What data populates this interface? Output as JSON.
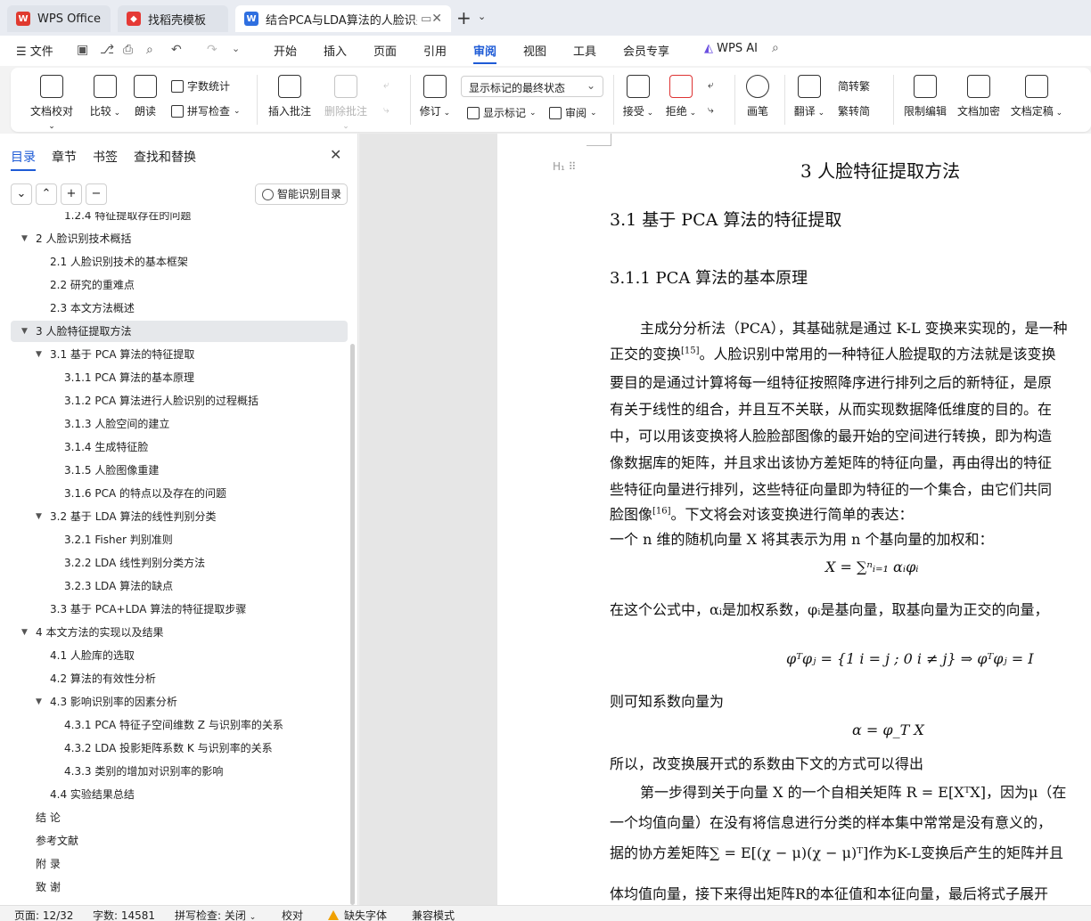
{
  "tabs": [
    {
      "label": "WPS Office",
      "icon": "wps-logo-icon",
      "color": "#e03a2f"
    },
    {
      "label": "找稻壳模板",
      "icon": "docer-icon",
      "color": "#e53935"
    },
    {
      "label": "结合PCA与LDA算法的人脸识别",
      "icon": "word-doc-icon",
      "color": "#2f6fe0"
    }
  ],
  "menu": {
    "file": "文件",
    "items": [
      "开始",
      "插入",
      "页面",
      "引用",
      "审阅",
      "视图",
      "工具",
      "会员专享"
    ],
    "active": "审阅",
    "wps_ai": "WPS AI"
  },
  "ribbon": {
    "proofread": "文档校对",
    "compare": "比较",
    "read_aloud": "朗读",
    "word_count": "字数统计",
    "spell_check": "拼写检查",
    "insert_comment": "插入批注",
    "delete_comment": "删除批注",
    "track_changes": "修订",
    "markup_state": "显示标记的最终状态",
    "show_markup": "显示标记",
    "review_pane": "审阅",
    "accept": "接受",
    "reject": "拒绝",
    "pen": "画笔",
    "translate": "翻译",
    "to_traditional": "简转繁",
    "to_simplified": "繁转简",
    "restrict_edit": "限制编辑",
    "encrypt": "文档加密",
    "finalize": "文档定稿"
  },
  "navpane": {
    "tabs": [
      "目录",
      "章节",
      "书签",
      "查找和替换"
    ],
    "active_tab": "目录",
    "smart_toc": "智能识别目录",
    "toc": [
      {
        "text": "1.2.4 特征提取存在的问题",
        "level": 3
      },
      {
        "text": "2 人脸识别技术概括",
        "level": 1,
        "toggle": "▼"
      },
      {
        "text": "2.1 人脸识别技术的基本框架",
        "level": 2
      },
      {
        "text": "2.2 研究的重难点",
        "level": 2
      },
      {
        "text": "2.3 本文方法概述",
        "level": 2
      },
      {
        "text": "3 人脸特征提取方法",
        "level": 1,
        "toggle": "▼",
        "selected": true
      },
      {
        "text": "3.1 基于 PCA 算法的特征提取",
        "level": 2,
        "toggle": "▼"
      },
      {
        "text": "3.1.1 PCA 算法的基本原理",
        "level": 3
      },
      {
        "text": "3.1.2 PCA 算法进行人脸识别的过程概括",
        "level": 3
      },
      {
        "text": "3.1.3 人脸空间的建立",
        "level": 3
      },
      {
        "text": "3.1.4 生成特征脸",
        "level": 3
      },
      {
        "text": "3.1.5 人脸图像重建",
        "level": 3
      },
      {
        "text": "3.1.6 PCA 的特点以及存在的问题",
        "level": 3
      },
      {
        "text": "3.2 基于 LDA 算法的线性判别分类",
        "level": 2,
        "toggle": "▼"
      },
      {
        "text": "3.2.1 Fisher 判别准则",
        "level": 3
      },
      {
        "text": "3.2.2 LDA 线性判别分类方法",
        "level": 3
      },
      {
        "text": "3.2.3 LDA 算法的缺点",
        "level": 3
      },
      {
        "text": "3.3 基于 PCA+LDA 算法的特征提取步骤",
        "level": 2
      },
      {
        "text": "4 本文方法的实现以及结果",
        "level": 1,
        "toggle": "▼"
      },
      {
        "text": "4.1 人脸库的选取",
        "level": 2
      },
      {
        "text": "4.2 算法的有效性分析",
        "level": 2
      },
      {
        "text": "4.3 影响识别率的因素分析",
        "level": 2,
        "toggle": "▼"
      },
      {
        "text": "4.3.1 PCA 特征子空间维数 Z 与识别率的关系",
        "level": 3
      },
      {
        "text": "4.3.2 LDA 投影矩阵系数 K 与识别率的关系",
        "level": 3
      },
      {
        "text": "4.3.3 类别的增加对识别率的影响",
        "level": 3
      },
      {
        "text": "4.4 实验结果总结",
        "level": 2
      },
      {
        "text": "结 论",
        "level": 1
      },
      {
        "text": "参考文献",
        "level": 1
      },
      {
        "text": "附 录",
        "level": 1
      },
      {
        "text": "致 谢",
        "level": 1
      }
    ]
  },
  "document": {
    "heading_handle": "H₁ ⠿",
    "h1": "3 人脸特征提取方法",
    "h2": "3.1 基于 PCA 算法的特征提取",
    "h3": "3.1.1 PCA 算法的基本原理",
    "lines": [
      "主成分分析法（PCA），其基础就是通过 K-L 变换来实现的，是一种",
      "正交的变换",
      "。人脸识别中常用的一种特征人脸提取的方法就是该变换",
      "要目的是通过计算将每一组特征按照降序进行排列之后的新特征，是原",
      "有关于线性的组合，并且互不关联，从而实现数据降低维度的目的。在",
      "中，可以用该变换将人脸脸部图像的最开始的空间进行转换，即为构造",
      "像数据库的矩阵，并且求出该协方差矩阵的特征向量，再由得出的特征",
      "些特征向量进行排列，这些特征向量即为特征的一个集合，由它们共同",
      "脸图像",
      "。下文将会对该变换进行简单的表达：",
      "一个 n 维的随机向量 X 将其表示为用 n 个基向量的加权和：",
      "X = ∑ⁿᵢ₌₁ αᵢφᵢ",
      "在这个公式中，αᵢ是加权系数，φᵢ是基向量，取基向量为正交的向量，",
      "φᵀφⱼ = {1  i = j ; 0  i ≠ j} ⇒ φᵀφⱼ = I",
      "则可知系数向量为",
      "α = φ_T X",
      "所以，改变换展开式的系数由下文的方式可以得出",
      "第一步得到关于向量 X 的一个自相关矩阵 R = E[XᵀX]，因为μ（在",
      "一个均值向量）在没有将信息进行分类的样本集中常常是没有意义的，",
      "据的协方差矩阵∑ = E[(χ − μ)(χ − μ)ᵀ]作为K-L变换后产生的矩阵并且",
      "体均值向量，接下来得出矩阵R的本征值和本征向量，最后将式子展开"
    ],
    "cite_15": "[15]",
    "cite_16": "[16]"
  },
  "status": {
    "page": "页面: 12/32",
    "words": "字数: 14581",
    "spell": "拼写检查: 关闭",
    "proof": "校对",
    "missing_font": "缺失字体",
    "compat": "兼容模式"
  },
  "colors": {
    "accent": "#1e5bd6",
    "warning": "#f0a000"
  }
}
